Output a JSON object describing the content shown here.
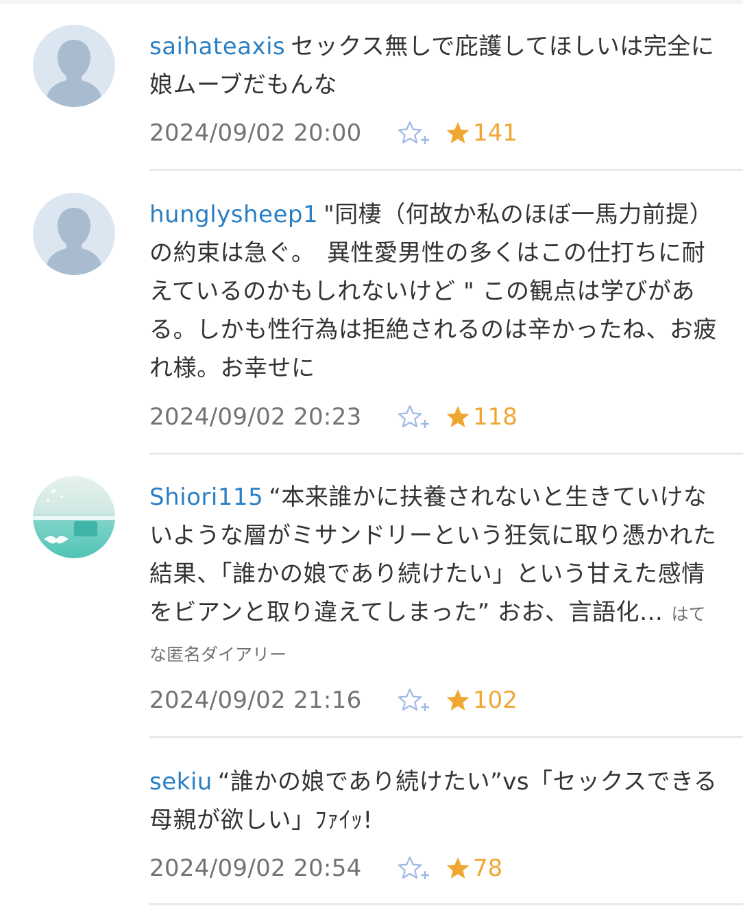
{
  "colors": {
    "username": "#2a7fc4",
    "star": "#f0a732",
    "add_star": "#9fb8e8",
    "meta_text": "#737373",
    "divider": "#e9e9e9"
  },
  "comments": [
    {
      "username": "saihateaxis",
      "text": "セックス無しで庇護してほしいは完全に娘ムーブだもんな",
      "source": "",
      "date": "2024/09/02 20:00",
      "stars": "141",
      "avatar_icon": "default-user-icon"
    },
    {
      "username": "hunglysheep1",
      "text": "\"同棲（何故か私のほぼ一馬力前提）の約束は急ぐ。　異性愛男性の多くはこの仕打ちに耐えているのかもしれないけど \" この観点は学びがある。しかも性行為は拒絶されるのは辛かったね、お疲れ様。お幸せに",
      "source": "",
      "date": "2024/09/02 20:23",
      "stars": "118",
      "avatar_icon": "default-user-icon"
    },
    {
      "username": "Shiori115",
      "text": "“本来誰かに扶養されないと生きていけないような層がミサンドリーという狂気に取り憑かれた結果、「誰かの娘であり続けたい」という甘えた感情をビアンと取り違えてしまった” おお、言語化…",
      "source": "はてな匿名ダイアリー",
      "date": "2024/09/02 21:16",
      "stars": "102",
      "avatar_icon": "photo-avatar-icon"
    },
    {
      "username": "sekiu",
      "text": "“誰かの娘であり続けたい”vs「セックスできる母親が欲しい」ﾌｧｲｯ!",
      "source": "",
      "date": "2024/09/02 20:54",
      "stars": "78",
      "avatar_icon": "blank-avatar-icon"
    }
  ]
}
